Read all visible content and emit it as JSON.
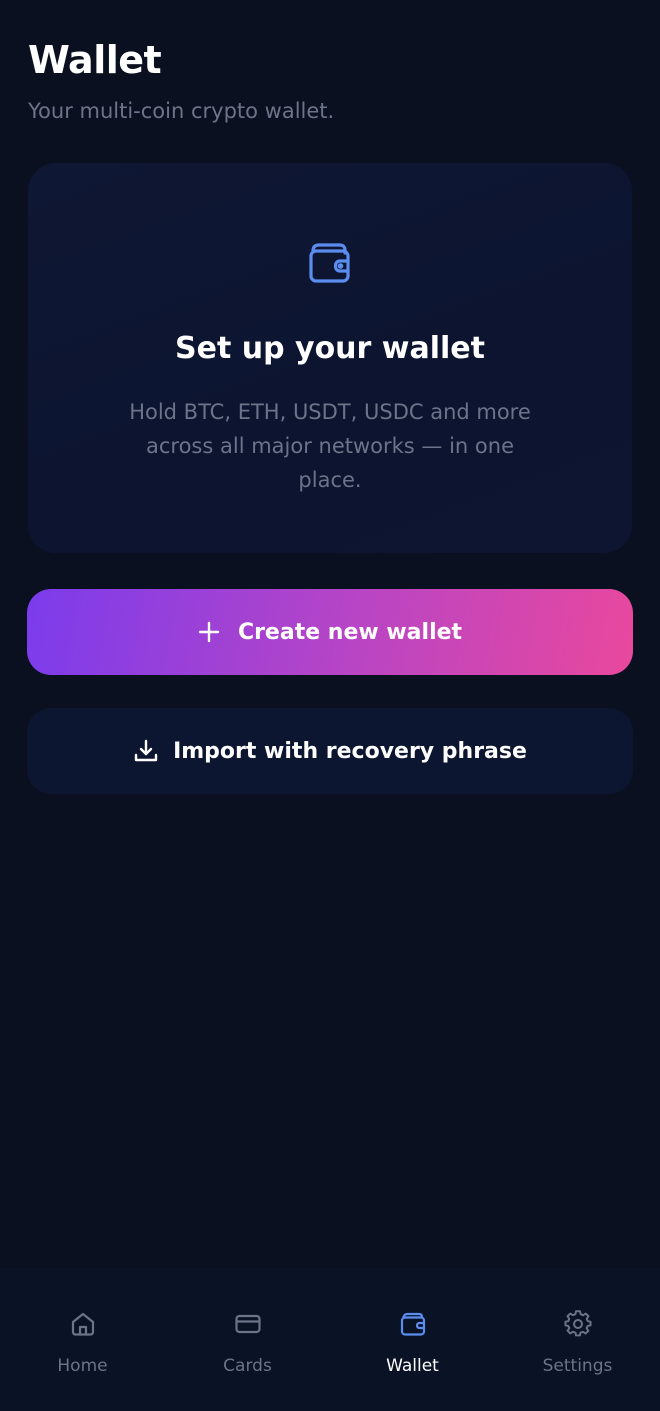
{
  "header": {
    "title": "Wallet",
    "subtitle": "Your multi-coin crypto wallet."
  },
  "setup_card": {
    "icon": "wallet-icon",
    "title": "Set up your wallet",
    "description": "Hold BTC, ETH, USDT, USDC and more across all major networks — in one place."
  },
  "actions": {
    "create_label": "Create new wallet",
    "create_icon": "plus-icon",
    "import_label": "Import with recovery phrase",
    "import_icon": "download-icon"
  },
  "nav": {
    "items": [
      {
        "label": "Home",
        "icon": "home-icon",
        "active": false
      },
      {
        "label": "Cards",
        "icon": "card-icon",
        "active": false
      },
      {
        "label": "Wallet",
        "icon": "wallet-icon",
        "active": true
      },
      {
        "label": "Settings",
        "icon": "gear-icon",
        "active": false
      }
    ]
  },
  "colors": {
    "background": "#0b1020",
    "accent_blue": "#5b8def",
    "gradient_start": "#7b3cec",
    "gradient_end": "#e9489d",
    "muted_text": "#6b7488"
  }
}
